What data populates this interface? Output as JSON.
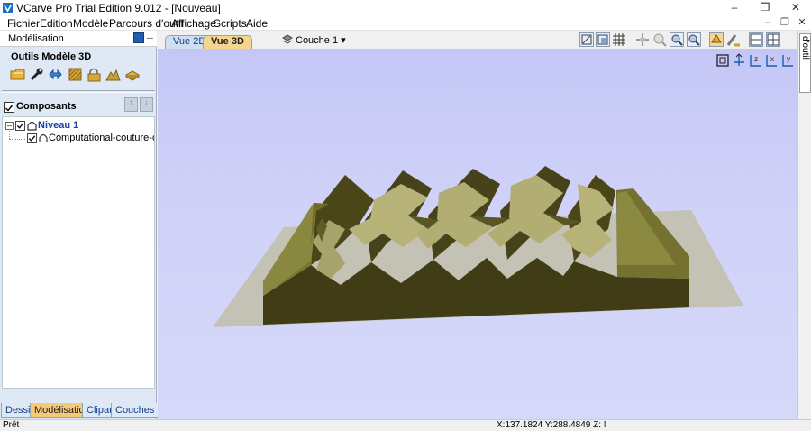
{
  "window": {
    "title": "VCarve Pro Trial Edition 9.012 - [Nouveau]",
    "minimize": "–",
    "restore": "❐",
    "close": "✕"
  },
  "menu": {
    "items": [
      "Fichier",
      "Edition",
      "Modèle",
      "Parcours d'outil",
      "Affichage",
      "Scripts",
      "Aide"
    ],
    "mdi_minimize": "–",
    "mdi_restore": "❐",
    "mdi_close": "✕"
  },
  "left_panel": {
    "title": "Modélisation",
    "pin_glyph": "ᵩ",
    "tools_title": "Outils Modèle 3D",
    "tool_icons": [
      "import-component-icon",
      "wrench-icon",
      "arrows-icon",
      "texture-icon",
      "lock-bake-icon",
      "mountain-icon",
      "slice-icon"
    ],
    "components_title": "Composants",
    "tree": {
      "level_label": "Niveau 1",
      "component_label": "Computational-couture-origam"
    },
    "scroll_left": "<",
    "scroll_right": ">"
  },
  "bottom_tabs": [
    "Dessin",
    "Modélisation",
    "Clipart",
    "Couches"
  ],
  "view_toolbar": {
    "tab_2d": "Vue 2D",
    "tab_3d": "Vue 3D",
    "layer": "Couche 1",
    "layer_arrow": "▾"
  },
  "right_tab": "Parcours d'outil",
  "status": {
    "text": "Prêt",
    "coords": "X:137.1824 Y:288.4849 Z: !"
  },
  "colors": {
    "viewport_bg": "#c9cbf7",
    "base_plane": "#c3c2b4",
    "model_dark": "#403d16",
    "model_mid": "#716f2f",
    "model_light": "#b7b277",
    "active_tab": "#f6c97a"
  }
}
